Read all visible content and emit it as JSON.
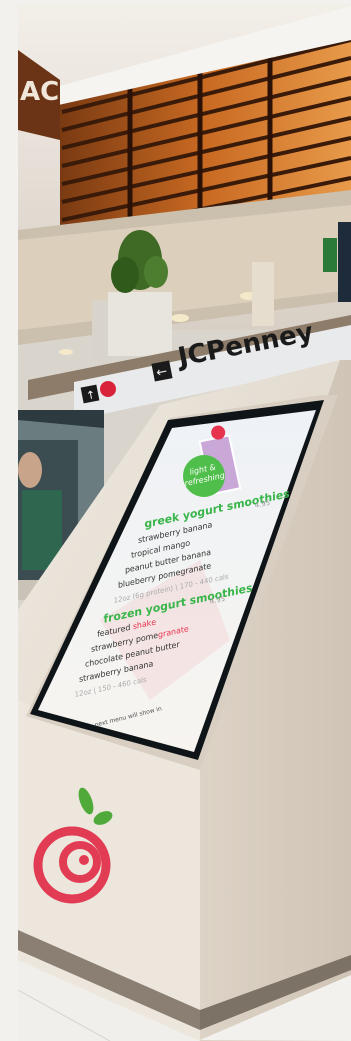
{
  "image": {
    "store_sign": {
      "brand": "JCPenney",
      "arrow_glyph": "←"
    },
    "kiosk_menu": {
      "badge_text": "light & refreshing",
      "section1": {
        "title": "greek yogurt smoothies",
        "price": "4.95",
        "items": [
          "strawberry banana",
          "tropical mango",
          "peanut butter banana",
          "blueberry pomegranate"
        ],
        "note": "12oz (6g protein) | 170 - 440 cals"
      },
      "section2": {
        "title": "frozen yogurt smoothies",
        "price": "4.95",
        "items": [
          {
            "label": "featured ",
            "highlight": "shake"
          },
          {
            "label": "strawberry pome",
            "highlight": "granate"
          },
          {
            "label": "chocolate peanut butter"
          },
          {
            "label": "strawberry banana"
          }
        ],
        "note": "12oz | 150 - 460 cals"
      },
      "footer_note": "next menu will show in"
    },
    "colors": {
      "accent_green": "#39b54a",
      "highlight_red": "#e8334f",
      "logo_red": "#e23c55",
      "logo_green": "#4faa3a",
      "kiosk_stone": "#e9e3da"
    }
  }
}
